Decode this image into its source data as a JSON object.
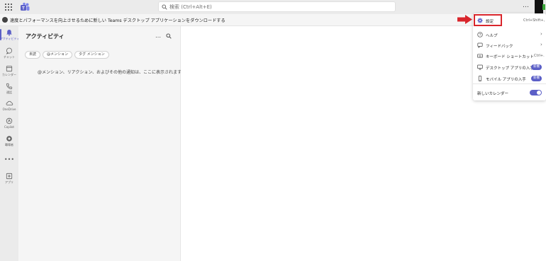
{
  "titlebar": {
    "search_placeholder": "検索 (Ctrl+Alt+E)",
    "more_label": "…"
  },
  "banner": {
    "text": "速度とパフォーマンスを向上させるために新しい Teams デスクトップ アプリケーションをダウンロードする"
  },
  "rail": {
    "items": [
      {
        "label": "アクティビティ",
        "icon": "bell-icon"
      },
      {
        "label": "チャット",
        "icon": "chat-icon"
      },
      {
        "label": "カレンダー",
        "icon": "calendar-icon"
      },
      {
        "label": "通話",
        "icon": "phone-icon"
      },
      {
        "label": "OneDrive",
        "icon": "cloud-icon"
      },
      {
        "label": "Copilot",
        "icon": "copilot-icon"
      },
      {
        "label": "職場者",
        "icon": "viva-icon"
      },
      {
        "label": "アプリ",
        "icon": "add-app-icon"
      }
    ],
    "more_label": "•••"
  },
  "panel": {
    "title": "アクティビティ",
    "more_label": "…",
    "filters": [
      "未読",
      "@メンション",
      "タグ メンション"
    ],
    "empty_message": "@メンション、リアクション、およびその他の通知は、ここに表示されます。"
  },
  "menu": {
    "items": [
      {
        "label": "設定",
        "shortcut": "Ctrl+Shift+,",
        "icon": "gear-icon"
      },
      {
        "label": "ヘルプ",
        "chevron": "›",
        "icon": "help-icon"
      },
      {
        "label": "フィードバック",
        "chevron": "›",
        "icon": "feedback-icon"
      },
      {
        "label": "キーボード ショートカット",
        "shortcut": "Ctrl+.",
        "icon": "keyboard-icon"
      },
      {
        "label": "デスクトップ アプリの入手",
        "badge": "新機",
        "icon": "desktop-icon"
      },
      {
        "label": "モバイル アプリの入手",
        "badge": "新機",
        "icon": "mobile-icon"
      },
      {
        "label": "新しいカレンダー",
        "toggle": "on",
        "icon": ""
      }
    ]
  },
  "colors": {
    "accent": "#5b5fc7",
    "highlight": "#d9262c",
    "rail_bg": "#ebebeb",
    "panel_bg": "#f5f5f5"
  }
}
